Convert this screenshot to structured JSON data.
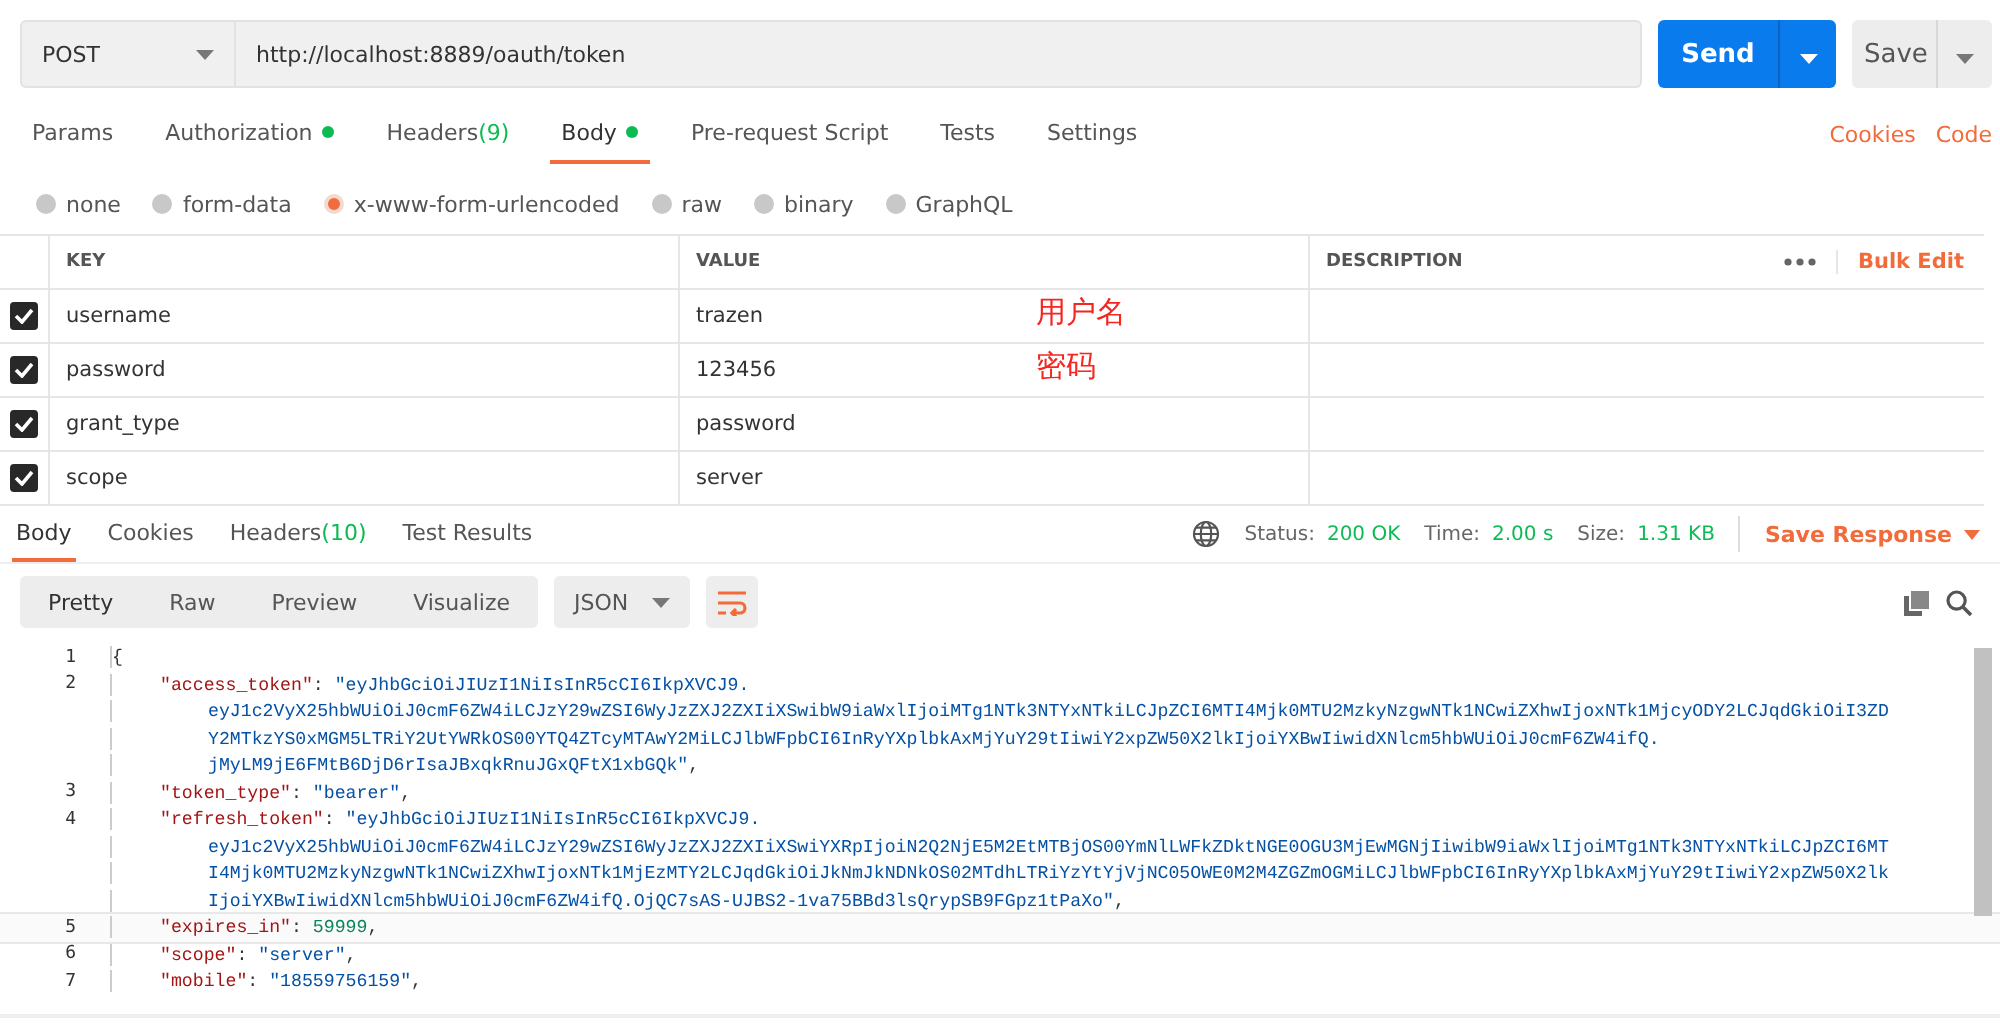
{
  "request": {
    "method": "POST",
    "url": "http://localhost:8889/oauth/token",
    "send": "Send",
    "save": "Save"
  },
  "tabs": [
    {
      "label": "Params",
      "selected": false,
      "dot": false
    },
    {
      "label": "Authorization",
      "selected": false,
      "dot": true
    },
    {
      "label": "Headers",
      "count": "(9)",
      "selected": false,
      "dot": false
    },
    {
      "label": "Body",
      "selected": true,
      "dot": true
    },
    {
      "label": "Pre-request Script",
      "selected": false,
      "dot": false
    },
    {
      "label": "Tests",
      "selected": false,
      "dot": false
    },
    {
      "label": "Settings",
      "selected": false,
      "dot": false
    }
  ],
  "links": [
    "Cookies",
    "Code"
  ],
  "body_types": [
    {
      "label": "none",
      "selected": false
    },
    {
      "label": "form-data",
      "selected": false
    },
    {
      "label": "x-www-form-urlencoded",
      "selected": true
    },
    {
      "label": "raw",
      "selected": false
    },
    {
      "label": "binary",
      "selected": false
    },
    {
      "label": "GraphQL",
      "selected": false
    }
  ],
  "params_table": {
    "columns": [
      "KEY",
      "VALUE",
      "DESCRIPTION"
    ],
    "bulk_edit": "Bulk Edit",
    "rows": [
      {
        "checked": true,
        "key": "username",
        "value": "trazen",
        "note": "用户名"
      },
      {
        "checked": true,
        "key": "password",
        "value": "123456",
        "note": "密码"
      },
      {
        "checked": true,
        "key": "grant_type",
        "value": "password"
      },
      {
        "checked": true,
        "key": "scope",
        "value": "server"
      }
    ]
  },
  "response_tabs": [
    {
      "label": "Body",
      "selected": true
    },
    {
      "label": "Cookies",
      "selected": false
    },
    {
      "label": "Headers",
      "count": "(10)",
      "selected": false
    },
    {
      "label": "Test Results",
      "selected": false
    }
  ],
  "response_meta": {
    "status_label": "Status:",
    "status": "200 OK",
    "time_label": "Time:",
    "time": "2.00 s",
    "size_label": "Size:",
    "size": "1.31 KB",
    "save_response": "Save Response"
  },
  "view_modes": [
    {
      "label": "Pretty",
      "selected": true
    },
    {
      "label": "Raw",
      "selected": false
    },
    {
      "label": "Preview",
      "selected": false
    },
    {
      "label": "Visualize",
      "selected": false
    }
  ],
  "format": "JSON",
  "code_lines": [
    {
      "number": "1",
      "kind": "brace",
      "tokens": [
        {
          "kind": "punct",
          "text": "{"
        }
      ]
    },
    {
      "number": "2",
      "kind": "entry",
      "tokens": [
        {
          "kind": "key",
          "text": "\"access_token\""
        },
        {
          "kind": "punct",
          "text": ": "
        },
        {
          "kind": "string",
          "text": "\"eyJhbGciOiJIUzI1NiIsInR5cCI6IkpXVCJ9."
        }
      ]
    },
    {
      "kind": "wrap",
      "tokens": [
        {
          "kind": "string",
          "text": "eyJ1c2VyX25hbWUiOiJ0cmF6ZW4iLCJzY29wZSI6WyJzZXJ2ZXIiXSwibW9iaWxlIjoiMTg1NTk3NTYxNTkiLCJpZCI6MTI4Mjk0MTU2MzkyNzgwNTk1NCwiZXhwIjoxNTk1MjcyODY2LCJqdGkiOiI3ZD"
        }
      ]
    },
    {
      "kind": "wrap",
      "tokens": [
        {
          "kind": "string",
          "text": "Y2MTkzYS0xMGM5LTRiY2UtYWRkOS00YTQ4ZTcyMTAwY2MiLCJlbWFpbCI6InRyYXplbkAxMjYuY29tIiwiY2xpZW50X2lkIjoiYXBwIiwidXNlcm5hbWUiOiJ0cmF6ZW4ifQ."
        }
      ]
    },
    {
      "kind": "wrap",
      "tokens": [
        {
          "kind": "string",
          "text": "jMyLM9jE6FMtB6DjD6rIsaJBxqkRnuJGxQFtX1xbGQk\""
        },
        {
          "kind": "punct",
          "text": ","
        }
      ]
    },
    {
      "number": "3",
      "kind": "entry",
      "tokens": [
        {
          "kind": "key",
          "text": "\"token_type\""
        },
        {
          "kind": "punct",
          "text": ": "
        },
        {
          "kind": "string",
          "text": "\"bearer\""
        },
        {
          "kind": "punct",
          "text": ","
        }
      ]
    },
    {
      "number": "4",
      "kind": "entry",
      "tokens": [
        {
          "kind": "key",
          "text": "\"refresh_token\""
        },
        {
          "kind": "punct",
          "text": ": "
        },
        {
          "kind": "string",
          "text": "\"eyJhbGciOiJIUzI1NiIsInR5cCI6IkpXVCJ9."
        }
      ]
    },
    {
      "kind": "wrap",
      "tokens": [
        {
          "kind": "string",
          "text": "eyJ1c2VyX25hbWUiOiJ0cmF6ZW4iLCJzY29wZSI6WyJzZXJ2ZXIiXSwiYXRpIjoiN2Q2NjE5M2EtMTBjOS00YmNlLWFkZDktNGE0OGU3MjEwMGNjIiwibW9iaWxlIjoiMTg1NTk3NTYxNTkiLCJpZCI6MT"
        }
      ]
    },
    {
      "kind": "wrap",
      "tokens": [
        {
          "kind": "string",
          "text": "I4Mjk0MTU2MzkyNzgwNTk1NCwiZXhwIjoxNTk1MjEzMTY2LCJqdGkiOiJkNmJkNDNkOS02MTdhLTRiYzYtYjVjNC05OWE0M2M4ZGZmOGMiLCJlbWFpbCI6InRyYXplbkAxMjYuY29tIiwiY2xpZW50X2lk"
        }
      ]
    },
    {
      "kind": "wrap",
      "tokens": [
        {
          "kind": "string",
          "text": "IjoiYXBwIiwidXNlcm5hbWUiOiJ0cmF6ZW4ifQ.OjQC7sAS-UJBS2-1va75BBd3lsQrypSB9FGpz1tPaXo\""
        },
        {
          "kind": "punct",
          "text": ","
        }
      ]
    },
    {
      "number": "5",
      "kind": "entry",
      "current": true,
      "tokens": [
        {
          "kind": "key",
          "text": "\"expires_in\""
        },
        {
          "kind": "punct",
          "text": ": "
        },
        {
          "kind": "number",
          "text": "59999"
        },
        {
          "kind": "punct",
          "text": ","
        }
      ]
    },
    {
      "number": "6",
      "kind": "entry",
      "current": false,
      "tokens": [
        {
          "kind": "key",
          "text": "\"scope\""
        },
        {
          "kind": "punct",
          "text": ": "
        },
        {
          "kind": "string",
          "text": "\"server\""
        },
        {
          "kind": "punct",
          "text": ","
        }
      ]
    },
    {
      "number": "7",
      "kind": "entry",
      "current": false,
      "tokens": [
        {
          "kind": "key",
          "text": "\"mobile\""
        },
        {
          "kind": "punct",
          "text": ": "
        },
        {
          "kind": "string",
          "text": "\"18559756159\""
        },
        {
          "kind": "punct",
          "text": ","
        }
      ]
    }
  ]
}
